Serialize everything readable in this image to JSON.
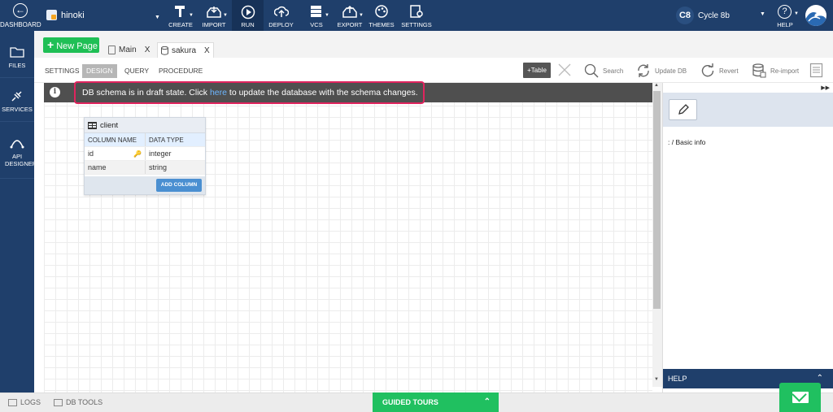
{
  "topbar": {
    "dashboard_label": "DASHBOARD",
    "project_name": "hinoki",
    "tools": [
      {
        "label": "CREATE"
      },
      {
        "label": "IMPORT"
      },
      {
        "label": "RUN"
      },
      {
        "label": "DEPLOY"
      },
      {
        "label": "VCS"
      },
      {
        "label": "EXPORT"
      },
      {
        "label": "THEMES"
      },
      {
        "label": "SETTINGS"
      }
    ],
    "cycle_badge": "C8",
    "cycle_name": "Cycle 8b",
    "help_label": "HELP"
  },
  "sidebar": {
    "items": [
      {
        "label": "FILES"
      },
      {
        "label": "SERVICES"
      },
      {
        "label": "API DESIGNER"
      }
    ]
  },
  "tabs": {
    "new_page": "New Page",
    "pages": [
      {
        "label": "Main",
        "close": "X"
      },
      {
        "label": "sakura",
        "close": "X"
      }
    ]
  },
  "subbar": {
    "tabs": [
      "SETTINGS",
      "DESIGN",
      "QUERY",
      "PROCEDURE"
    ],
    "add_table": "+Table",
    "search": "Search",
    "update_db": "Update DB",
    "revert": "Revert",
    "reimport": "Re-import"
  },
  "info": {
    "prefix": "DB schema is in draft state. Click ",
    "link": "here",
    "suffix": " to update the database with the schema changes."
  },
  "entity": {
    "name": "client",
    "col_header": "COLUMN NAME",
    "type_header": "DATA TYPE",
    "rows": [
      {
        "name": "id",
        "type": "integer"
      },
      {
        "name": "name",
        "type": "string"
      }
    ],
    "add_column": "ADD COLUMN"
  },
  "right_panel": {
    "basic_info": ": / Basic info",
    "help": "HELP"
  },
  "bottom": {
    "logs": "LOGS",
    "db_tools": "DB TOOLS",
    "guided_tours": "GUIDED TOURS"
  },
  "colors": {
    "nav": "#1f3f6b",
    "green": "#20c060",
    "highlight": "#e0245e",
    "link": "#6cb6ff"
  }
}
